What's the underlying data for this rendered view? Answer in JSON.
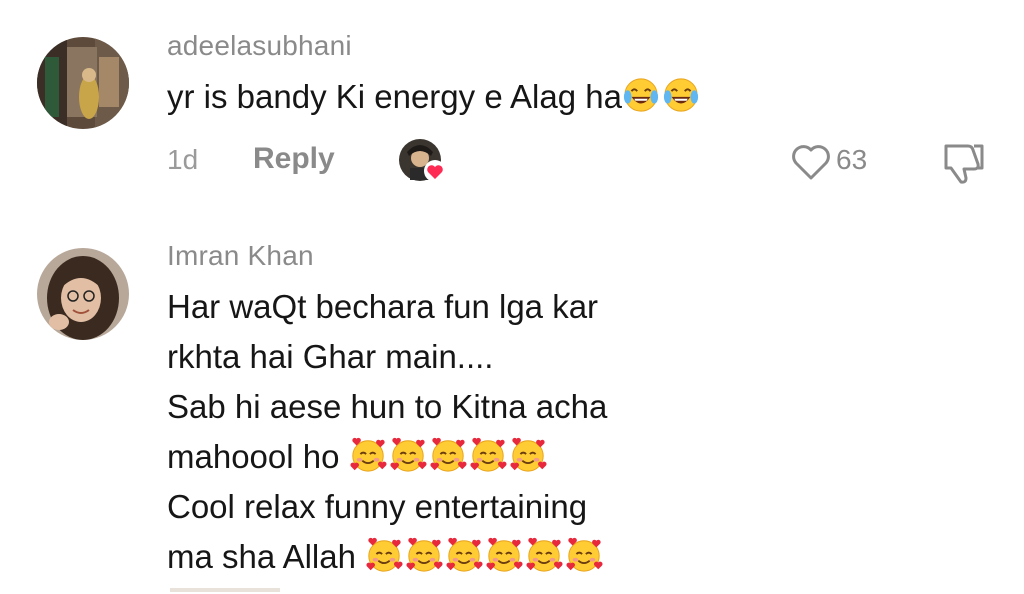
{
  "comments": [
    {
      "username": "adeelasubhani",
      "lines": [
        "yr is bandy Ki energy e Alag ha"
      ],
      "age": "1d",
      "reply_label": "Reply",
      "like_count": "63",
      "avatar": "avatar-photo",
      "emoji": "face-with-tears-of-joy"
    },
    {
      "username": "Imran Khan",
      "lines": [
        "Har waQt bechara fun lga kar",
        "rkhta hai Ghar main....",
        "Sab hi aese hun to Kitna acha",
        "mahoool ho",
        "Cool relax funny entertaining",
        "ma sha Allah"
      ],
      "avatar": "avatar-photo",
      "emoji": "smiling-face-with-hearts"
    }
  ],
  "icons": {
    "like": "heart-outline-icon",
    "dislike": "thumbs-down-icon",
    "creator_liked": "creator-liked-avatar-icon"
  },
  "colors": {
    "text": "#161616",
    "muted": "#8a8a8a",
    "heart_badge": "#fe2c55"
  }
}
